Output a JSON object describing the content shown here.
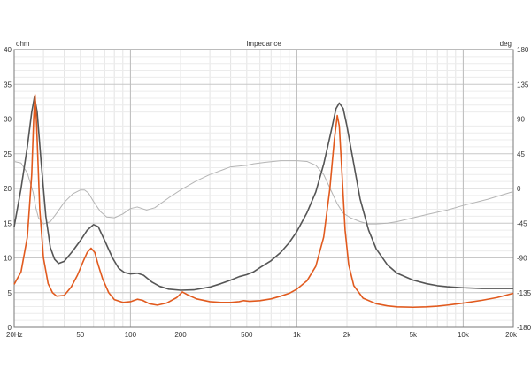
{
  "chart_data": {
    "type": "line",
    "title": "Impedance",
    "y_left_unit": "ohm",
    "y_right_unit": "deg",
    "x_scale": "log",
    "xlim": [
      20,
      20000
    ],
    "ylim_left": [
      0,
      40
    ],
    "ylim_right": [
      -180,
      180
    ],
    "x_ticks": [
      {
        "value": 20,
        "label": "20Hz"
      },
      {
        "value": 50,
        "label": "50"
      },
      {
        "value": 100,
        "label": "100"
      },
      {
        "value": 200,
        "label": "200"
      },
      {
        "value": 500,
        "label": "500"
      },
      {
        "value": 1000,
        "label": "1k"
      },
      {
        "value": 2000,
        "label": "2k"
      },
      {
        "value": 5000,
        "label": "5k"
      },
      {
        "value": 10000,
        "label": "10k"
      },
      {
        "value": 20000,
        "label": "20k"
      }
    ],
    "y_left_ticks": [
      "0",
      "5",
      "10",
      "15",
      "20",
      "25",
      "30",
      "35",
      "40"
    ],
    "y_right_ticks": [
      "-180",
      "-135",
      "-90",
      "-45",
      "0",
      "45",
      "90",
      "135",
      "180"
    ],
    "grid": true,
    "series": [
      {
        "axis": "left",
        "color": "#555555",
        "points": [
          [
            20,
            14.5
          ],
          [
            22,
            20
          ],
          [
            24,
            26
          ],
          [
            25.5,
            31
          ],
          [
            26.5,
            33.2
          ],
          [
            27.5,
            31
          ],
          [
            29,
            24
          ],
          [
            31,
            16
          ],
          [
            33,
            11.5
          ],
          [
            35,
            9.8
          ],
          [
            37,
            9.2
          ],
          [
            40,
            9.5
          ],
          [
            45,
            11
          ],
          [
            50,
            12.5
          ],
          [
            55,
            14
          ],
          [
            60,
            14.8
          ],
          [
            64,
            14.5
          ],
          [
            70,
            12.5
          ],
          [
            78,
            10
          ],
          [
            85,
            8.5
          ],
          [
            92,
            7.9
          ],
          [
            100,
            7.7
          ],
          [
            110,
            7.8
          ],
          [
            120,
            7.5
          ],
          [
            135,
            6.5
          ],
          [
            150,
            5.9
          ],
          [
            170,
            5.5
          ],
          [
            200,
            5.35
          ],
          [
            240,
            5.4
          ],
          [
            300,
            5.8
          ],
          [
            350,
            6.3
          ],
          [
            400,
            6.8
          ],
          [
            450,
            7.3
          ],
          [
            500,
            7.6
          ],
          [
            550,
            8.0
          ],
          [
            600,
            8.6
          ],
          [
            700,
            9.6
          ],
          [
            800,
            10.8
          ],
          [
            900,
            12.2
          ],
          [
            1000,
            13.8
          ],
          [
            1150,
            16.5
          ],
          [
            1300,
            19.5
          ],
          [
            1450,
            23.5
          ],
          [
            1600,
            28
          ],
          [
            1720,
            31.5
          ],
          [
            1800,
            32.3
          ],
          [
            1900,
            31.5
          ],
          [
            2000,
            29
          ],
          [
            2200,
            23.5
          ],
          [
            2400,
            18.5
          ],
          [
            2700,
            14
          ],
          [
            3000,
            11.3
          ],
          [
            3500,
            9
          ],
          [
            4000,
            7.8
          ],
          [
            5000,
            6.8
          ],
          [
            6000,
            6.3
          ],
          [
            7000,
            6.0
          ],
          [
            8000,
            5.85
          ],
          [
            10000,
            5.7
          ],
          [
            13000,
            5.6
          ],
          [
            20000,
            5.6
          ]
        ]
      },
      {
        "axis": "left",
        "color": "#e15a1e",
        "points": [
          [
            20,
            6.2
          ],
          [
            22,
            8
          ],
          [
            24,
            13
          ],
          [
            25.5,
            22
          ],
          [
            26.2,
            30
          ],
          [
            26.7,
            33.5
          ],
          [
            27.3,
            29
          ],
          [
            28.5,
            17
          ],
          [
            30,
            10
          ],
          [
            32,
            6.3
          ],
          [
            34,
            5
          ],
          [
            36,
            4.5
          ],
          [
            40,
            4.6
          ],
          [
            44,
            5.8
          ],
          [
            48,
            7.5
          ],
          [
            52,
            9.5
          ],
          [
            55,
            10.8
          ],
          [
            58,
            11.4
          ],
          [
            61,
            10.8
          ],
          [
            64,
            9
          ],
          [
            68,
            7
          ],
          [
            74,
            5
          ],
          [
            80,
            4
          ],
          [
            90,
            3.6
          ],
          [
            100,
            3.7
          ],
          [
            110,
            4.05
          ],
          [
            118,
            3.9
          ],
          [
            130,
            3.4
          ],
          [
            145,
            3.2
          ],
          [
            165,
            3.5
          ],
          [
            190,
            4.3
          ],
          [
            205,
            5.1
          ],
          [
            220,
            4.7
          ],
          [
            250,
            4.1
          ],
          [
            300,
            3.7
          ],
          [
            350,
            3.6
          ],
          [
            400,
            3.6
          ],
          [
            450,
            3.7
          ],
          [
            480,
            3.85
          ],
          [
            520,
            3.75
          ],
          [
            600,
            3.85
          ],
          [
            700,
            4.1
          ],
          [
            800,
            4.5
          ],
          [
            900,
            4.9
          ],
          [
            1000,
            5.5
          ],
          [
            1150,
            6.7
          ],
          [
            1300,
            8.8
          ],
          [
            1450,
            13
          ],
          [
            1580,
            20
          ],
          [
            1680,
            27
          ],
          [
            1750,
            30.5
          ],
          [
            1800,
            29
          ],
          [
            1870,
            22
          ],
          [
            1950,
            14
          ],
          [
            2050,
            9
          ],
          [
            2200,
            6
          ],
          [
            2500,
            4.2
          ],
          [
            3000,
            3.4
          ],
          [
            3500,
            3.1
          ],
          [
            4000,
            2.95
          ],
          [
            5000,
            2.9
          ],
          [
            6000,
            2.95
          ],
          [
            7000,
            3.05
          ],
          [
            8000,
            3.2
          ],
          [
            10000,
            3.5
          ],
          [
            13000,
            3.9
          ],
          [
            16000,
            4.3
          ],
          [
            20000,
            4.9
          ]
        ]
      },
      {
        "axis": "right",
        "color": "#b4b4b4",
        "points": [
          [
            20,
            35
          ],
          [
            22,
            33
          ],
          [
            24,
            20
          ],
          [
            26,
            -5
          ],
          [
            27,
            -25
          ],
          [
            28,
            -38
          ],
          [
            30,
            -46
          ],
          [
            33,
            -43
          ],
          [
            36,
            -32
          ],
          [
            40,
            -18
          ],
          [
            45,
            -7
          ],
          [
            50,
            -2
          ],
          [
            53,
            -2
          ],
          [
            56,
            -6
          ],
          [
            60,
            -17
          ],
          [
            66,
            -30
          ],
          [
            72,
            -37
          ],
          [
            80,
            -38
          ],
          [
            90,
            -33
          ],
          [
            100,
            -26
          ],
          [
            110,
            -24
          ],
          [
            125,
            -28
          ],
          [
            140,
            -25
          ],
          [
            170,
            -12
          ],
          [
            200,
            -2
          ],
          [
            250,
            10
          ],
          [
            300,
            18
          ],
          [
            400,
            28
          ],
          [
            500,
            30
          ],
          [
            550,
            32
          ],
          [
            650,
            34
          ],
          [
            800,
            36
          ],
          [
            1000,
            36
          ],
          [
            1150,
            35
          ],
          [
            1300,
            30
          ],
          [
            1450,
            18
          ],
          [
            1600,
            -2
          ],
          [
            1750,
            -20
          ],
          [
            1900,
            -32
          ],
          [
            2100,
            -38
          ],
          [
            2400,
            -43
          ],
          [
            2700,
            -46
          ],
          [
            3000,
            -46
          ],
          [
            3500,
            -45
          ],
          [
            4000,
            -43
          ],
          [
            5000,
            -38
          ],
          [
            6000,
            -34
          ],
          [
            8000,
            -28
          ],
          [
            10000,
            -22
          ],
          [
            14000,
            -14
          ],
          [
            20000,
            -4
          ]
        ]
      }
    ]
  }
}
